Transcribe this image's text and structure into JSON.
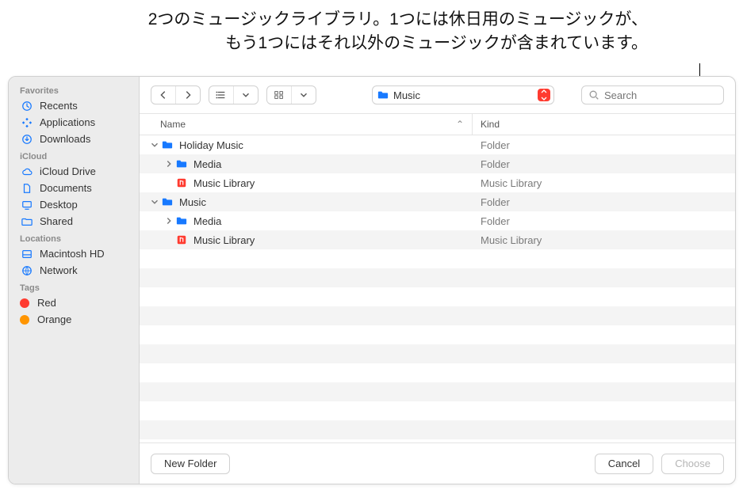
{
  "annotation": {
    "line1": "2つのミュージックライブラリ。1つには休日用のミュージックが、",
    "line2": "もう1つにはそれ以外のミュージックが含まれています。"
  },
  "sidebar": {
    "sections": [
      {
        "heading": "Favorites",
        "items": [
          {
            "icon": "clock-icon",
            "label": "Recents"
          },
          {
            "icon": "apps-icon",
            "label": "Applications"
          },
          {
            "icon": "download-icon",
            "label": "Downloads"
          }
        ]
      },
      {
        "heading": "iCloud",
        "items": [
          {
            "icon": "cloud-icon",
            "label": "iCloud Drive"
          },
          {
            "icon": "doc-icon",
            "label": "Documents"
          },
          {
            "icon": "desktop-icon",
            "label": "Desktop"
          },
          {
            "icon": "shared-icon",
            "label": "Shared"
          }
        ]
      },
      {
        "heading": "Locations",
        "items": [
          {
            "icon": "disk-icon",
            "label": "Macintosh HD"
          },
          {
            "icon": "globe-icon",
            "label": "Network"
          }
        ]
      },
      {
        "heading": "Tags",
        "items": [
          {
            "icon": "tag-dot",
            "color": "#ff3b30",
            "label": "Red"
          },
          {
            "icon": "tag-dot",
            "color": "#ff9500",
            "label": "Orange"
          }
        ]
      }
    ]
  },
  "toolbar": {
    "path_label": "Music",
    "search_placeholder": "Search"
  },
  "columns": {
    "name": "Name",
    "kind": "Kind"
  },
  "rows": [
    {
      "depth": 0,
      "disclosure": "down",
      "icon": "folder",
      "name": "Holiday Music",
      "kind": "Folder"
    },
    {
      "depth": 1,
      "disclosure": "right",
      "icon": "folder",
      "name": "Media",
      "kind": "Folder"
    },
    {
      "depth": 1,
      "disclosure": "none",
      "icon": "library",
      "name": "Music Library",
      "kind": "Music Library"
    },
    {
      "depth": 0,
      "disclosure": "down",
      "icon": "folder",
      "name": "Music",
      "kind": "Folder"
    },
    {
      "depth": 1,
      "disclosure": "right",
      "icon": "folder",
      "name": "Media",
      "kind": "Folder"
    },
    {
      "depth": 1,
      "disclosure": "none",
      "icon": "library",
      "name": "Music Library",
      "kind": "Music Library"
    }
  ],
  "extra_rows": 12,
  "buttons": {
    "new_folder": "New Folder",
    "cancel": "Cancel",
    "choose": "Choose"
  }
}
